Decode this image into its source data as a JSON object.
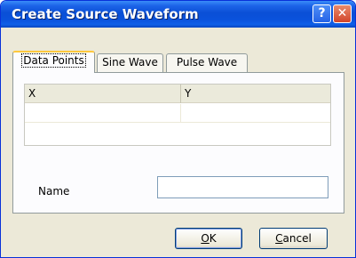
{
  "window": {
    "title": "Create Source Waveform",
    "help_glyph": "?",
    "close_glyph": "✕"
  },
  "tabs": [
    {
      "label": "Data Points",
      "active": true
    },
    {
      "label": "Sine Wave",
      "active": false
    },
    {
      "label": "Pulse Wave",
      "active": false
    }
  ],
  "grid": {
    "columns": [
      "X",
      "Y"
    ],
    "rows": [
      [
        "",
        ""
      ]
    ]
  },
  "name_field": {
    "label": "Name",
    "value": ""
  },
  "buttons": {
    "ok_mnemonic": "O",
    "ok_rest": "K",
    "cancel_mnemonic": "C",
    "cancel_rest": "ancel"
  },
  "colors": {
    "title_bar": "#0a4fd6",
    "dialog_bg": "#ece9d8",
    "active_tab_accent": "#ffc83c"
  }
}
